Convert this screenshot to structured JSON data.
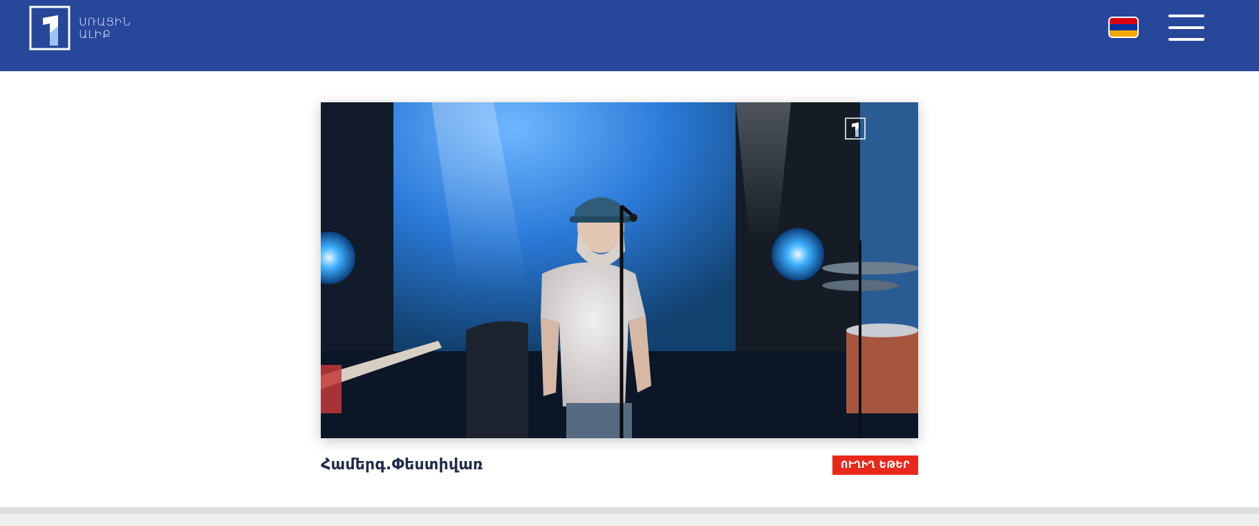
{
  "header": {
    "logo": {
      "line1": "ՍՌԱՑԻՆ",
      "line2": "ԱԼԻՔ"
    },
    "language_flag": {
      "name": "Armenian",
      "colors": [
        "#d90012",
        "#0033a0",
        "#f2a800"
      ]
    },
    "menu_icon": "hamburger-icon",
    "background_color": "#27479b"
  },
  "player": {
    "watermark_icon": "channel-logo-icon",
    "title": "Համերգ.Փեստիվառ",
    "live_label": "ՈՒՂԻՂ ԵԹԵՐ",
    "live_color": "#e8281a"
  }
}
